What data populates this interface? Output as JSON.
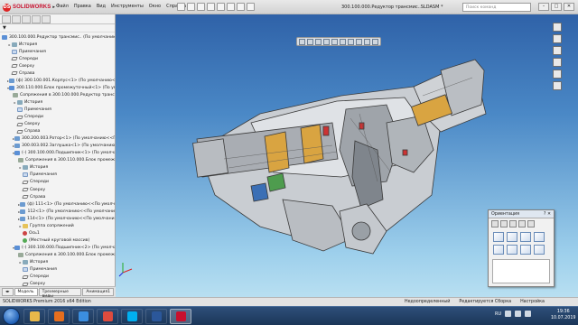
{
  "app": {
    "brand": "SOLIDWORKS",
    "logo_letters": "DS",
    "document_title": "300.100.000.Редуктор трансмис..SLDASM *",
    "search_placeholder": "Поиск команд",
    "menus": [
      "Файл",
      "Правка",
      "Вид",
      "Инструменты",
      "Окно",
      "Справка"
    ],
    "window_buttons": [
      "–",
      "□",
      "✕"
    ]
  },
  "feature_tree": {
    "filter_icon": "funnel-icon",
    "rows": [
      {
        "indent": 0,
        "expand": "",
        "icon": "asm",
        "label": "300.100.000.Редуктор трансмис.. (По умолчанию<По ум"
      },
      {
        "indent": 1,
        "expand": "▸",
        "icon": "hist",
        "label": "История"
      },
      {
        "indent": 1,
        "expand": "",
        "icon": "note",
        "label": "Примечания"
      },
      {
        "indent": 1,
        "expand": "",
        "icon": "plane",
        "label": "Спереди"
      },
      {
        "indent": 1,
        "expand": "",
        "icon": "plane",
        "label": "Сверху"
      },
      {
        "indent": 1,
        "expand": "",
        "icon": "plane",
        "label": "Справа"
      },
      {
        "indent": 1,
        "expand": "▸",
        "icon": "part",
        "label": "(ф) 300.100.001.Корпус<1> (По умолчанию<<По у"
      },
      {
        "indent": 1,
        "expand": "▾",
        "icon": "asm",
        "label": "300.110.000.Блок промежуточный<1> (По умолч"
      },
      {
        "indent": 2,
        "expand": "",
        "icon": "mate",
        "label": "Сопряжения в 300.100.000.Редуктор трансм"
      },
      {
        "indent": 2,
        "expand": "▸",
        "icon": "hist",
        "label": "История"
      },
      {
        "indent": 2,
        "expand": "",
        "icon": "note",
        "label": "Примечания"
      },
      {
        "indent": 2,
        "expand": "",
        "icon": "plane",
        "label": "Спереди"
      },
      {
        "indent": 2,
        "expand": "",
        "icon": "plane",
        "label": "Сверху"
      },
      {
        "indent": 2,
        "expand": "",
        "icon": "plane",
        "label": "Справа"
      },
      {
        "indent": 2,
        "expand": "▸",
        "icon": "part",
        "label": "300.200.003.Ротор<1> (По умолчанию<<По"
      },
      {
        "indent": 2,
        "expand": "▸",
        "icon": "part",
        "label": "300.003.002.Заглушка<1> (По умолчанию<<"
      },
      {
        "indent": 2,
        "expand": "▾",
        "icon": "asm",
        "label": "(-) 300.100.000.Подшипник<1> (По умолчан"
      },
      {
        "indent": 3,
        "expand": "",
        "icon": "mate",
        "label": "Сопряжения в 300.110.000.Блок промеж"
      },
      {
        "indent": 3,
        "expand": "▸",
        "icon": "hist",
        "label": "История"
      },
      {
        "indent": 3,
        "expand": "",
        "icon": "note",
        "label": "Примечания"
      },
      {
        "indent": 3,
        "expand": "",
        "icon": "plane",
        "label": "Спереди"
      },
      {
        "indent": 3,
        "expand": "",
        "icon": "plane",
        "label": "Сверху"
      },
      {
        "indent": 3,
        "expand": "",
        "icon": "plane",
        "label": "Справа"
      },
      {
        "indent": 3,
        "expand": "▸",
        "icon": "part",
        "label": "(ф) 111<1> (По умолчанию<<По умолч"
      },
      {
        "indent": 3,
        "expand": "▸",
        "icon": "part",
        "label": "112<1> (По умолчанию<<По умолчани"
      },
      {
        "indent": 3,
        "expand": "▸",
        "icon": "part",
        "label": "114<1> (По умолчанию<<По умолчанию"
      },
      {
        "indent": 3,
        "expand": "▸",
        "icon": "folder",
        "label": "Группа сопряжений"
      },
      {
        "indent": 3,
        "expand": "",
        "icon": "origin",
        "label": "Ось1"
      },
      {
        "indent": 3,
        "expand": "",
        "icon": "sensor",
        "label": "(Местный круговой массив)"
      },
      {
        "indent": 2,
        "expand": "▾",
        "icon": "asm",
        "label": "(-) 300.100.000.Подшипник<2> (По умолчан"
      },
      {
        "indent": 3,
        "expand": "",
        "icon": "mate",
        "label": "Сопряжения в 300.100.000.Блок промеж"
      },
      {
        "indent": 3,
        "expand": "▸",
        "icon": "hist",
        "label": "История"
      },
      {
        "indent": 3,
        "expand": "",
        "icon": "note",
        "label": "Примечания"
      },
      {
        "indent": 3,
        "expand": "",
        "icon": "plane",
        "label": "Спереди"
      },
      {
        "indent": 3,
        "expand": "",
        "icon": "plane",
        "label": "Сверху"
      },
      {
        "indent": 3,
        "expand": "",
        "icon": "plane",
        "label": "Справа"
      }
    ],
    "bottom_tabs": [
      "Модель",
      "Трехмерные виды",
      "Анимация1"
    ]
  },
  "orientation_dialog": {
    "title": "Ориентация",
    "controls": [
      "?",
      "✕"
    ]
  },
  "status_bar": {
    "left": "SOLIDWORKS Premium 2016 x64 Edition",
    "items": [
      "Недоопределенный",
      "Редактируется Сборка",
      "Настройка"
    ]
  },
  "taskbar": {
    "language": "RU",
    "time": "19:36",
    "date": "10.07.2019",
    "apps": [
      {
        "icon": "explorer-icon",
        "color": "#e7b84a"
      },
      {
        "icon": "media-player-icon",
        "color": "#e56e1e"
      },
      {
        "icon": "browser-icon",
        "color": "#3b8ee0"
      },
      {
        "icon": "chrome-icon",
        "color": "#dd4b3e"
      },
      {
        "icon": "skype-icon",
        "color": "#00aff0"
      },
      {
        "icon": "word-icon",
        "color": "#2b579a"
      },
      {
        "icon": "solidworks-icon",
        "color": "#c8102e"
      }
    ]
  }
}
